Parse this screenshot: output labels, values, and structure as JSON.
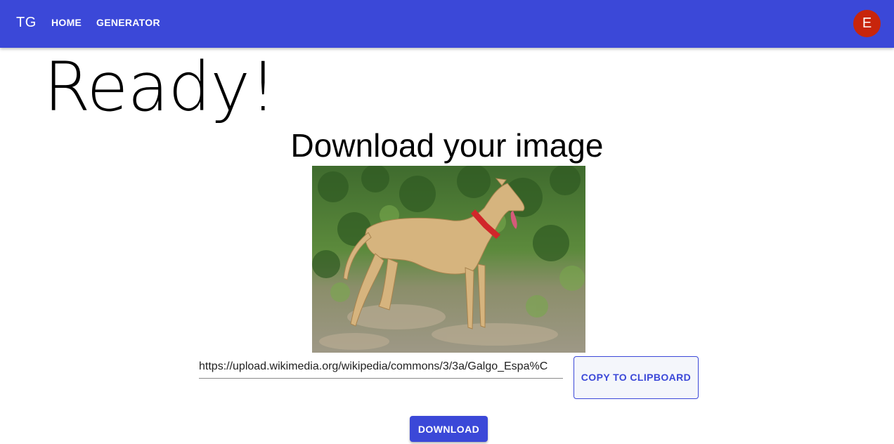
{
  "appbar": {
    "brand": "TG",
    "nav": [
      {
        "label": "HOME"
      },
      {
        "label": "GENERATOR"
      }
    ],
    "avatar_letter": "E",
    "color": "#3b48d8",
    "avatar_color": "#c8250c"
  },
  "main": {
    "heading": "Ready!",
    "subheading": "Download your image",
    "image_icon": "greyhound-dog-photo",
    "url_value": "https://upload.wikimedia.org/wikipedia/commons/3/3a/Galgo_Espa%C",
    "copy_button": "COPY TO CLIPBOARD",
    "download_button": "DOWNLOAD"
  }
}
